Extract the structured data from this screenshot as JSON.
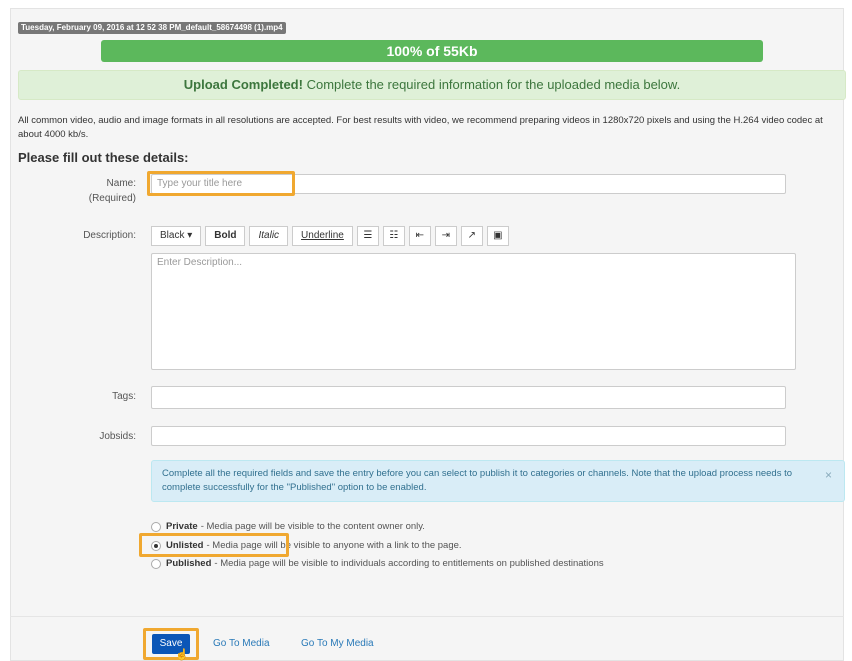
{
  "upload": {
    "filename": "Tuesday, February 09, 2016 at 12 52 38 PM_default_58674498 (1).mp4",
    "progress_text": "100% of 55Kb",
    "progress_percent": 100,
    "success_bold": "Upload Completed!",
    "success_text": "Complete the required information for the uploaded media below."
  },
  "info_text": "All common video, audio and image formats in all resolutions are accepted. For best results with video, we recommend preparing videos in 1280x720 pixels and using the H.264 video codec at about 4000 kb/s.",
  "form": {
    "title": "Please fill out these details:",
    "name_label": "Name:",
    "name_required": "(Required)",
    "name_placeholder": "Type your title here",
    "description_label": "Description:",
    "description_placeholder": "Enter Description...",
    "toolbar": {
      "color": "Black ▾",
      "bold": "Bold",
      "italic": "Italic",
      "underline": "Underline"
    },
    "tags_label": "Tags:",
    "jobsids_label": "Jobsids:"
  },
  "notice": {
    "text": "Complete all the required fields and save the entry before you can select to publish it to categories or channels. Note that the upload process needs to complete successfully for the \"Published\" option to be enabled.",
    "close": "×"
  },
  "publish_options": [
    {
      "label": "Private",
      "desc": " - Media page will be visible to the content owner only.",
      "checked": false
    },
    {
      "label": "Unlisted",
      "desc": " - Media page will be visible to anyone with a link to the page.",
      "checked": true
    },
    {
      "label": "Published",
      "desc": " - Media page will be visible to individuals according to entitlements on published destinations",
      "checked": false
    }
  ],
  "actions": {
    "save": "Save",
    "go_to_media": "Go To Media",
    "go_to_my_media": "Go To My Media"
  },
  "colors": {
    "progress": "#5cb85c",
    "highlight": "#f0a830",
    "save": "#0b56b7"
  }
}
